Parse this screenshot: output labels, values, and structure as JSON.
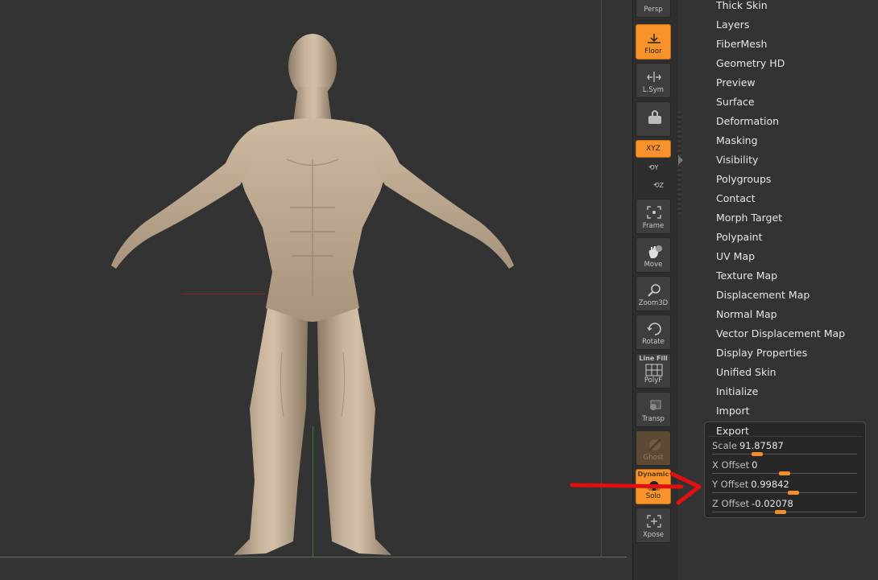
{
  "shelf": {
    "buttons": [
      {
        "label": "Persp",
        "state": "off"
      },
      {
        "label": "Floor",
        "state": "on"
      },
      {
        "label": "L.Sym",
        "state": "off"
      },
      {
        "label": "",
        "state": "off"
      },
      {
        "label": "XYZ",
        "state": "on"
      },
      {
        "label": "Y",
        "state": "off"
      },
      {
        "label": "Z",
        "state": "off"
      },
      {
        "label": "Frame",
        "state": "off"
      },
      {
        "label": "Move",
        "state": "off"
      },
      {
        "label": "Zoom3D",
        "state": "off"
      },
      {
        "label": "Rotate",
        "state": "off"
      },
      {
        "label": "PolyF",
        "top_label": "Line Fill",
        "state": "off"
      },
      {
        "label": "Transp",
        "state": "off"
      },
      {
        "label": "Ghost",
        "state": "disabled"
      },
      {
        "label": "Solo",
        "top_label": "Dynamic",
        "state": "on"
      },
      {
        "label": "Xpose",
        "state": "off"
      }
    ]
  },
  "panel": {
    "menu": [
      "Thick Skin",
      "Layers",
      "FiberMesh",
      "Geometry HD",
      "Preview",
      "Surface",
      "Deformation",
      "Masking",
      "Visibility",
      "Polygroups",
      "Contact",
      "Morph Target",
      "Polypaint",
      "UV Map",
      "Texture Map",
      "Displacement Map",
      "Normal Map",
      "Vector Displacement Map",
      "Display Properties",
      "Unified Skin",
      "Initialize",
      "Import"
    ],
    "export": {
      "title": "Export",
      "sliders": [
        {
          "name": "Scale",
          "value": "91.87587",
          "level": 0.31
        },
        {
          "name": "X Offset",
          "value": "0",
          "level": 0.5
        },
        {
          "name": "Y Offset",
          "value": "0.99842",
          "level": 0.56
        },
        {
          "name": "Z Offset",
          "value": "-0.02078",
          "level": 0.47
        }
      ]
    }
  },
  "colors": {
    "accent": "#f7932a",
    "viewport_bg": "#333333",
    "annotation_arrow": "#e01010",
    "model_skin": "#c6b29a"
  }
}
